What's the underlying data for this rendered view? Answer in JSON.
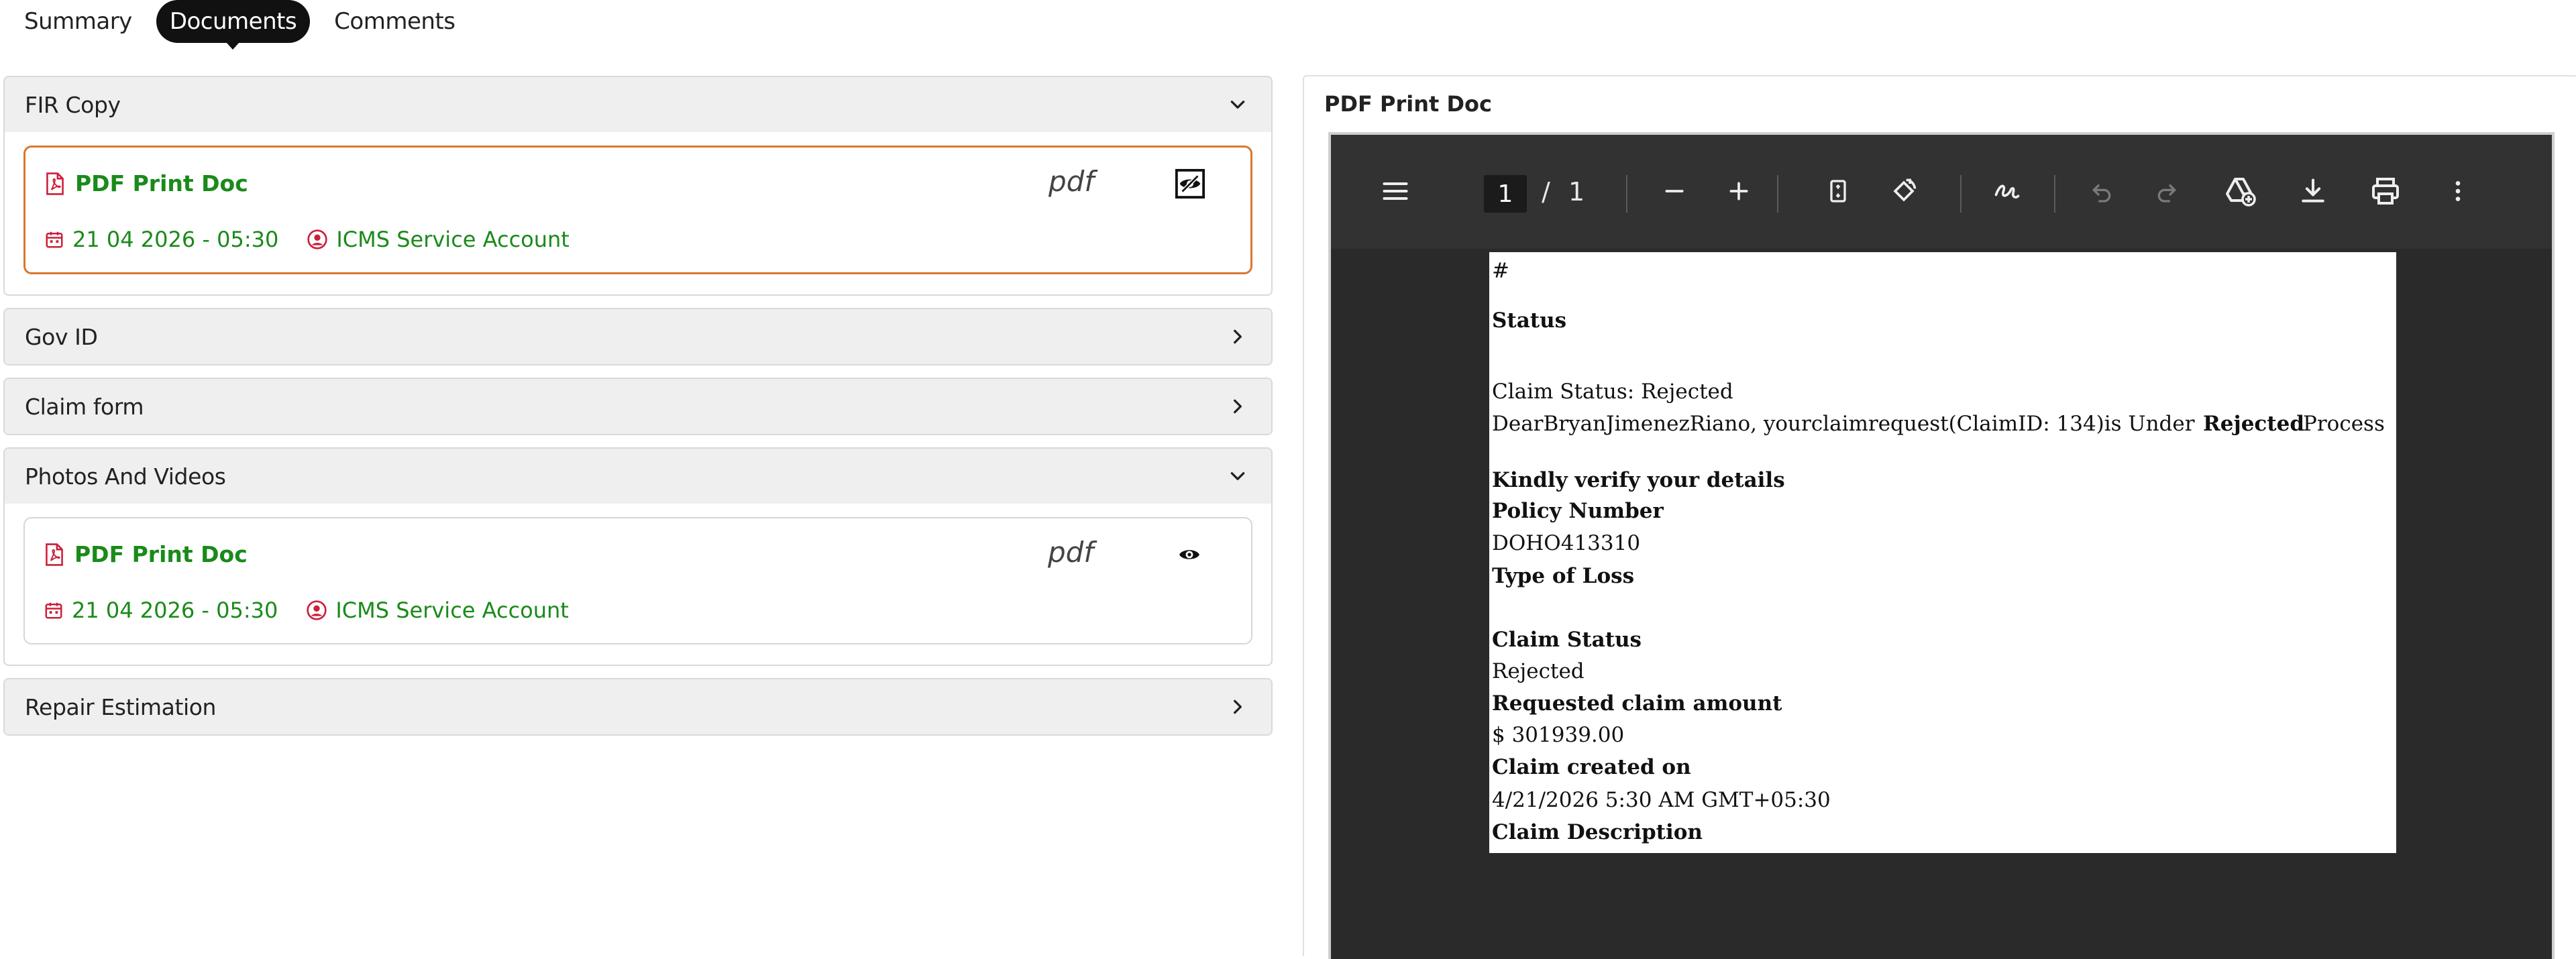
{
  "tabs": [
    {
      "label": "Summary",
      "active": false
    },
    {
      "label": "Documents",
      "active": true
    },
    {
      "label": "Comments",
      "active": false
    }
  ],
  "sections": [
    {
      "title": "FIR Copy",
      "expanded": true,
      "document": {
        "name": "PDF Print Doc",
        "type": "pdf",
        "date": "21 04 2026 - 05:30",
        "user": "ICMS Service Account",
        "selected": true,
        "view_icon": "eye-slash-icon"
      }
    },
    {
      "title": "Gov ID",
      "expanded": false
    },
    {
      "title": "Claim form",
      "expanded": false
    },
    {
      "title": "Photos And Videos",
      "expanded": true,
      "document": {
        "name": "PDF Print Doc",
        "type": "pdf",
        "date": "21 04 2026 - 05:30",
        "user": "ICMS Service Account",
        "selected": false,
        "view_icon": "eye-icon"
      }
    },
    {
      "title": "Repair Estimation",
      "expanded": false
    }
  ],
  "preview": {
    "title": "PDF Print Doc",
    "toolbar": {
      "page_current": "1",
      "page_separator": "/",
      "page_total": "1"
    },
    "page": {
      "hash": "#",
      "heading": "Status",
      "claim_status_line": "Claim Status: Rejected",
      "dear_line": "DearBryanJimenezRiano, yourclaimrequest(ClaimID: 134)is Under",
      "rejected_word": "Rejected",
      "process_word": "Process",
      "verify_heading": "Kindly verify your details",
      "policy_label": "Policy Number",
      "policy_value": "DOHO413310",
      "loss_label": "Type of Loss",
      "status_label": "Claim Status",
      "status_value": "Rejected",
      "amount_label": "Requested claim amount",
      "amount_value": "$ 301939.00",
      "created_label": "Claim created on",
      "created_value": "4/21/2026 5:30 AM GMT+05:30",
      "description_label": "Claim Description"
    }
  },
  "colors": {
    "accent_green": "#1a8a1a",
    "icon_red": "#cc1f3a",
    "selected_border": "#d9772e",
    "viewer_bg": "#2a2a2a"
  }
}
